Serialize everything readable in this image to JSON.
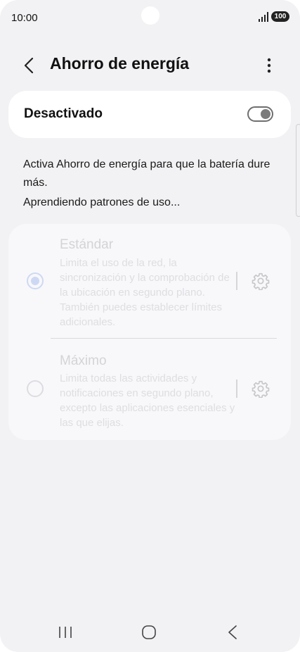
{
  "status_bar": {
    "time": "10:00",
    "battery": "100"
  },
  "app_bar": {
    "title": "Ahorro de energía"
  },
  "master_toggle": {
    "label": "Desactivado",
    "enabled": false
  },
  "description": "Activa Ahorro de energía para que la batería dure más.",
  "learning_status": "Aprendiendo patrones de uso...",
  "options": [
    {
      "title": "Estándar",
      "description": "Limita el uso de la red, la sincronización y la comprobación de la ubicación en segundo plano. También puedes establecer límites adicionales.",
      "selected": true
    },
    {
      "title": "Máximo",
      "description": "Limita todas las actividades y notificaciones en segundo plano, excepto las aplicaciones esenciales y las que elijas.",
      "selected": false
    }
  ],
  "icons": {
    "back": "chevron-left-icon",
    "more": "more-vert-icon",
    "settings": "gear-icon",
    "nav_recent": "recent-apps-icon",
    "nav_home": "home-icon",
    "nav_back": "nav-back-icon"
  },
  "colors": {
    "background": "#f2f2f4",
    "card": "#ffffff",
    "disabled_text": "#d4d4d8",
    "radio_selected": "#cdd9f4"
  }
}
